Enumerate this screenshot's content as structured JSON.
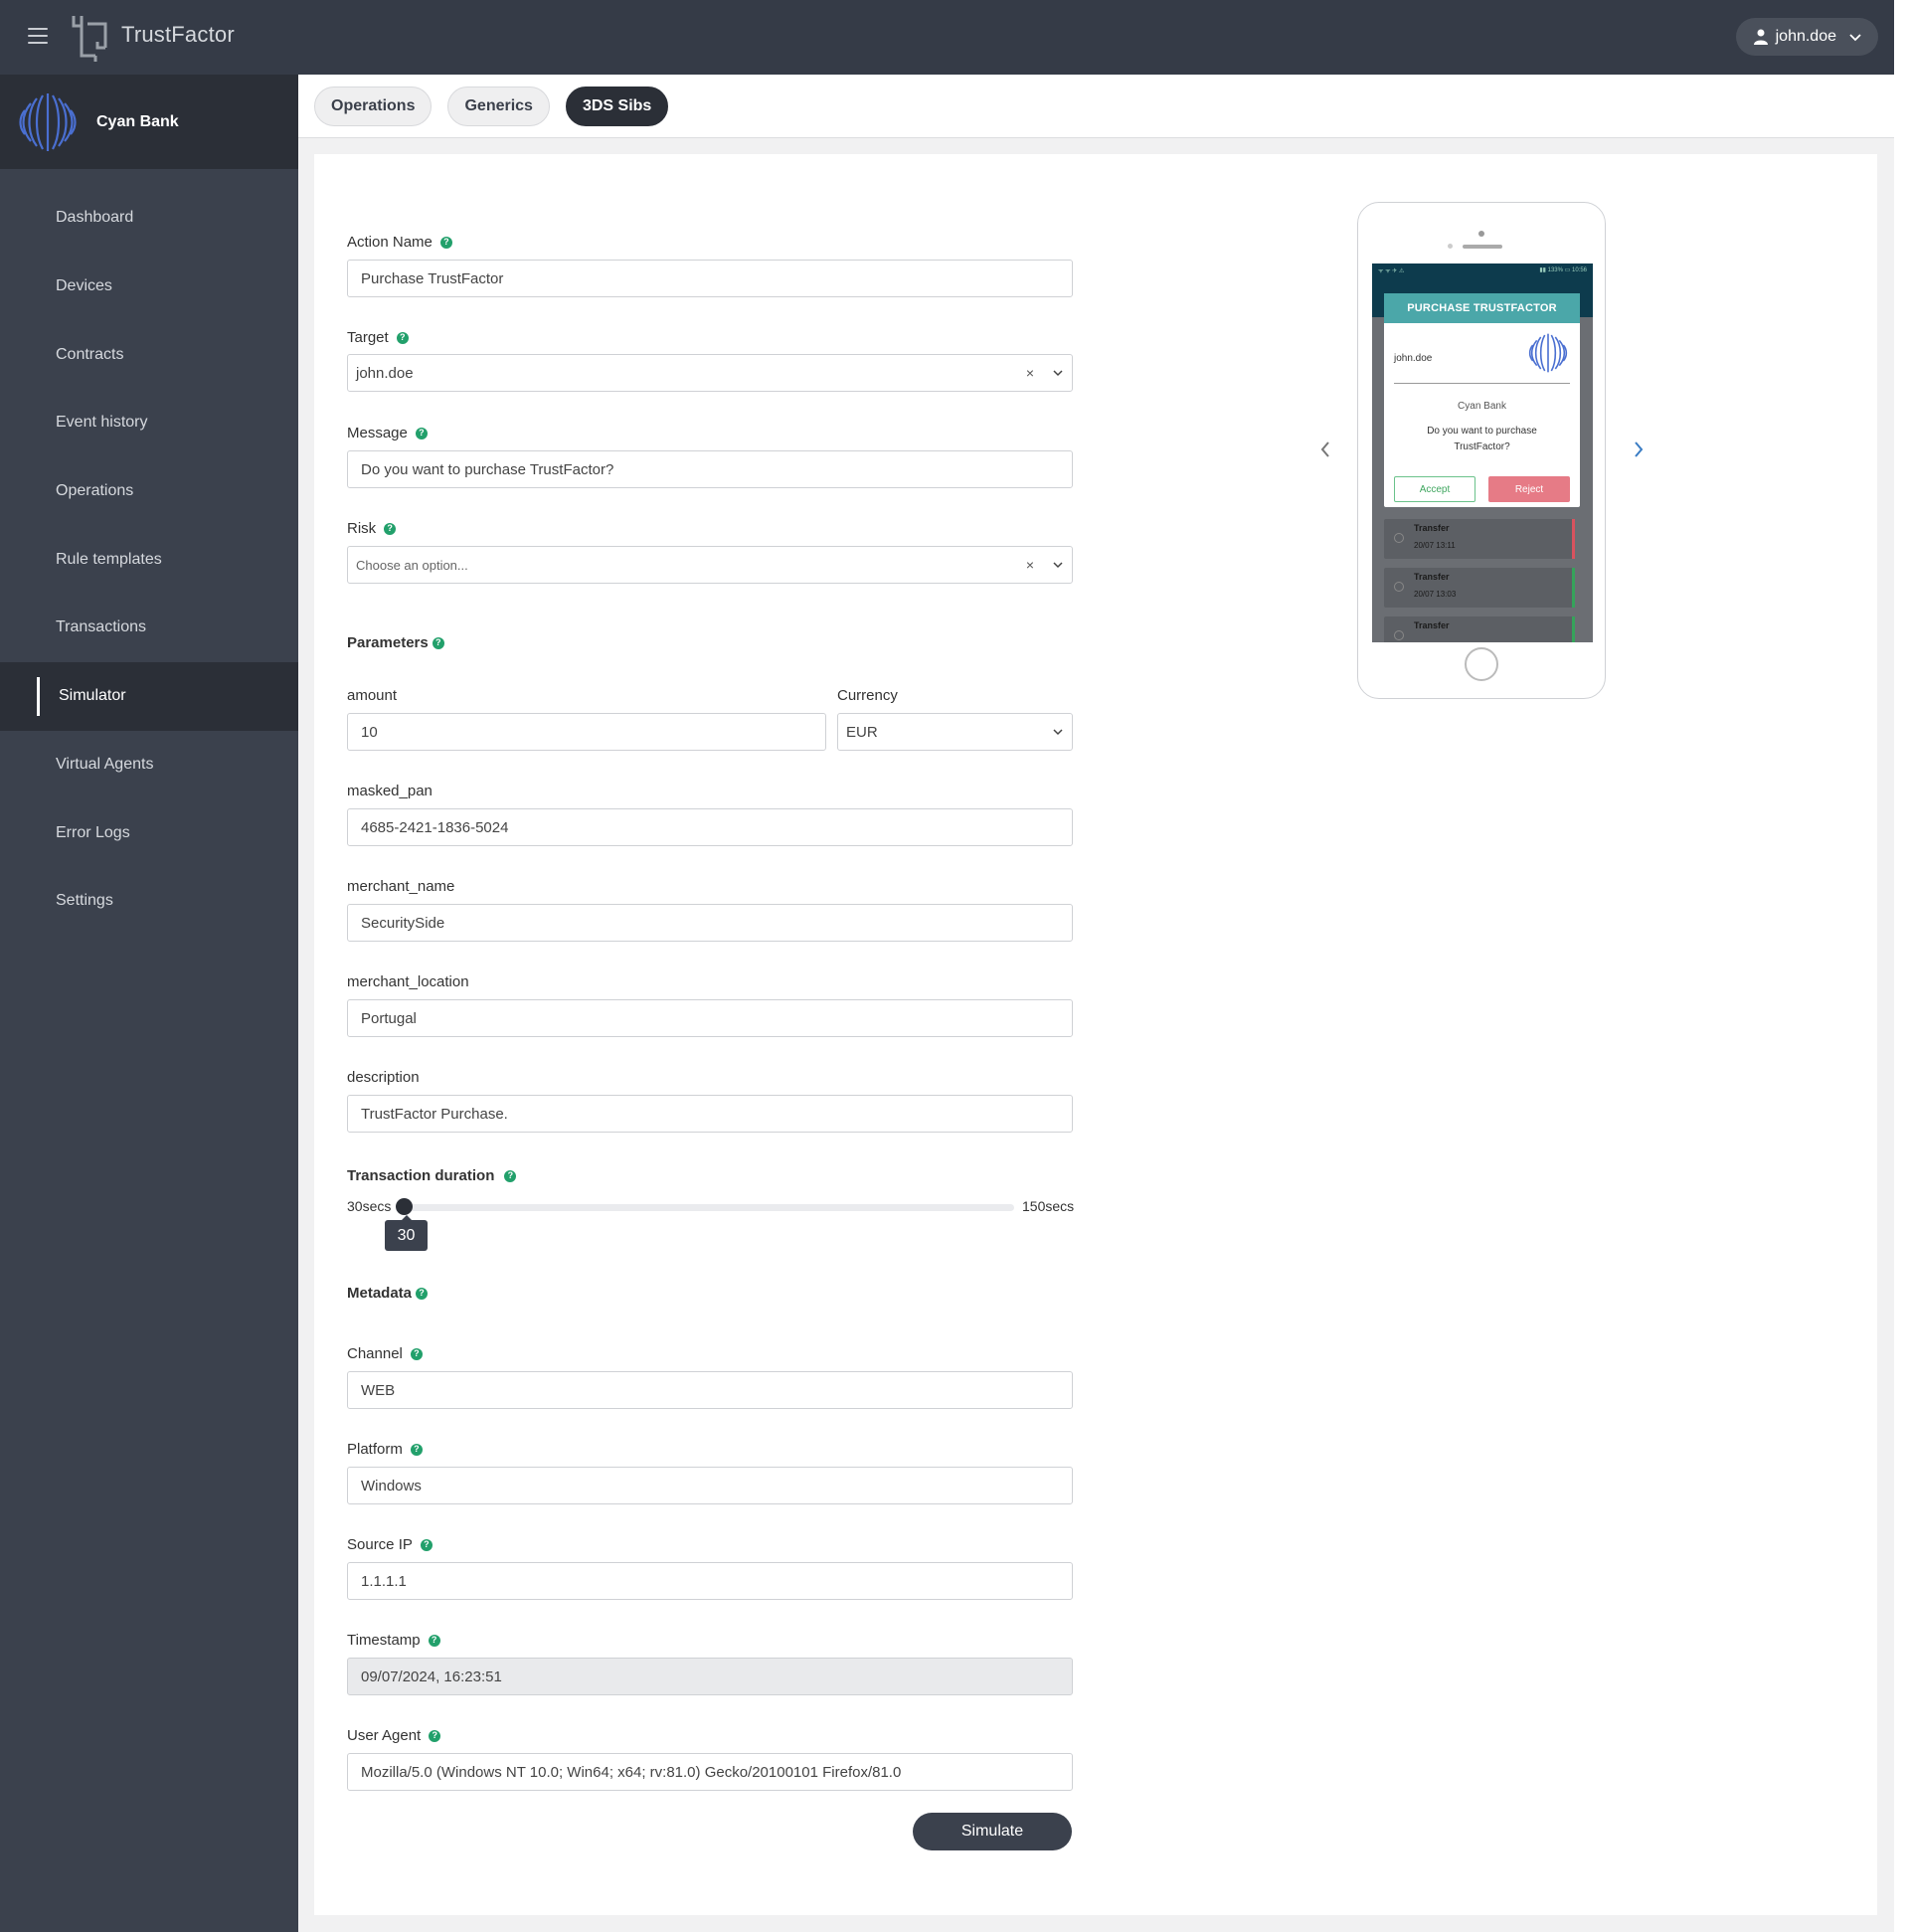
{
  "app": {
    "brand": "TrustFactor"
  },
  "user_menu": {
    "username": "john.doe"
  },
  "org": {
    "name": "Cyan Bank"
  },
  "sidebar": {
    "items": [
      {
        "label": "Dashboard"
      },
      {
        "label": "Devices"
      },
      {
        "label": "Contracts"
      },
      {
        "label": "Event history"
      },
      {
        "label": "Operations"
      },
      {
        "label": "Rule templates"
      },
      {
        "label": "Transactions"
      },
      {
        "label": "Simulator",
        "active": true
      },
      {
        "label": "Virtual Agents"
      },
      {
        "label": "Error Logs"
      },
      {
        "label": "Settings"
      }
    ]
  },
  "tabs": [
    {
      "label": "Operations"
    },
    {
      "label": "Generics"
    },
    {
      "label": "3DS Sibs",
      "active": true
    }
  ],
  "form": {
    "action_name": {
      "label": "Action Name",
      "value": "Purchase TrustFactor"
    },
    "target": {
      "label": "Target",
      "value": "john.doe"
    },
    "message": {
      "label": "Message",
      "value": "Do you want to purchase TrustFactor?"
    },
    "risk": {
      "label": "Risk",
      "placeholder": "Choose an option..."
    },
    "parameters": {
      "heading": "Parameters"
    },
    "amount": {
      "label": "amount",
      "value": "10"
    },
    "currency": {
      "label": "Currency",
      "value": "EUR"
    },
    "masked_pan": {
      "label": "masked_pan",
      "value": "4685-2421-1836-5024"
    },
    "merchant_name": {
      "label": "merchant_name",
      "value": "SecuritySide"
    },
    "merchant_location": {
      "label": "merchant_location",
      "value": "Portugal"
    },
    "description": {
      "label": "description",
      "value": "TrustFactor Purchase."
    },
    "transaction_duration": {
      "heading": "Transaction duration",
      "min_label": "30secs",
      "max_label": "150secs",
      "value": "30",
      "min": 30,
      "max": 150
    },
    "metadata": {
      "heading": "Metadata"
    },
    "channel": {
      "label": "Channel",
      "value": "WEB"
    },
    "platform": {
      "label": "Platform",
      "value": "Windows"
    },
    "source_ip": {
      "label": "Source IP",
      "value": "1.1.1.1"
    },
    "timestamp": {
      "label": "Timestamp",
      "value": "09/07/2024, 16:23:51"
    },
    "user_agent": {
      "label": "User Agent",
      "value": "Mozilla/5.0 (Windows NT 10.0; Win64; x64; rv:81.0) Gecko/20100101 Firefox/81.0"
    },
    "help_glyph": "?",
    "clear_glyph": "×",
    "simulate_label": "Simulate"
  },
  "preview": {
    "status_left": "ᯤ ᯤ ✈ ⚠",
    "status_right": "▮▮ 133% ▭ 10:56",
    "dialog_title": "PURCHASE TRUSTFACTOR",
    "user": "john.doe",
    "bank": "Cyan Bank",
    "message": "Do you want to purchase TrustFactor?",
    "accept_label": "Accept",
    "reject_label": "Reject",
    "transactions": [
      {
        "name": "Transfer",
        "date": "20/07 13:11",
        "color": "#d9525e"
      },
      {
        "name": "Transfer",
        "date": "20/07 13:03",
        "color": "#35a35a"
      },
      {
        "name": "Transfer",
        "date": "",
        "color": "#35a35a"
      }
    ]
  },
  "colors": {
    "topbar": "#353b47",
    "sidebar": "#3b414d",
    "accent_help": "#22a06b",
    "dialog_header": "#4ba7a9"
  }
}
